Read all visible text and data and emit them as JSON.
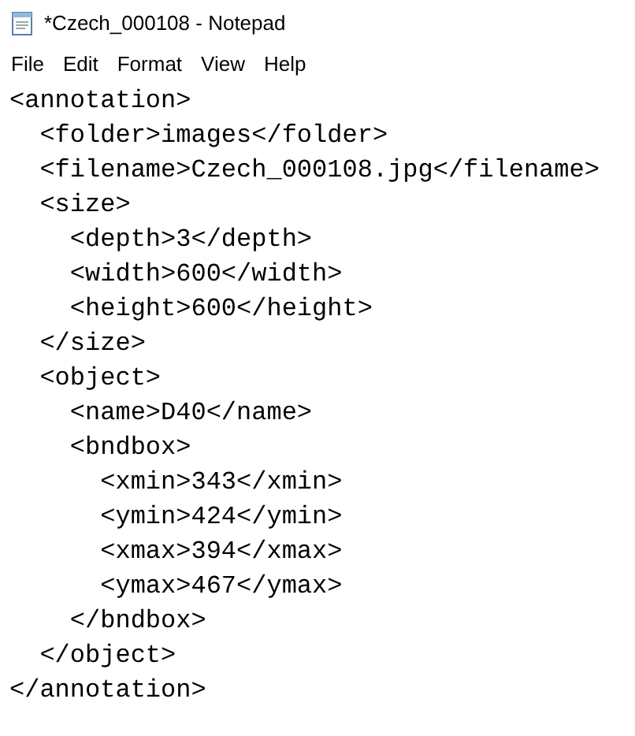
{
  "window": {
    "title": "*Czech_000108 - Notepad"
  },
  "menu": [
    "File",
    "Edit",
    "Format",
    "View",
    "Help"
  ],
  "editor": {
    "lines": [
      "<annotation>",
      "  <folder>images</folder>",
      "  <filename>Czech_000108.jpg</filename>",
      "  <size>",
      "    <depth>3</depth>",
      "    <width>600</width>",
      "    <height>600</height>",
      "  </size>",
      "  <object>",
      "    <name>D40</name>",
      "    <bndbox>",
      "      <xmin>343</xmin>",
      "      <ymin>424</ymin>",
      "      <xmax>394</xmax>",
      "      <ymax>467</ymax>",
      "    </bndbox>",
      "  </object>",
      "</annotation>"
    ]
  }
}
